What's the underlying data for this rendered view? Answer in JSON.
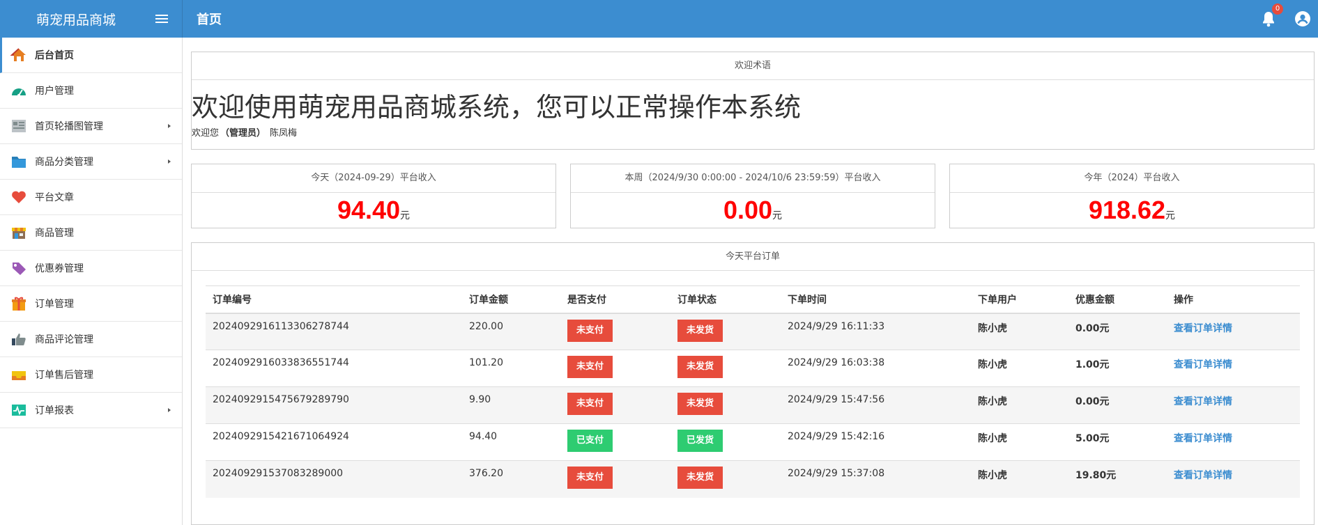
{
  "header": {
    "brand": "萌宠用品商城",
    "page_title": "首页",
    "notification_count": "0"
  },
  "sidebar": {
    "items": [
      {
        "label": "后台首页",
        "icon": "home-icon",
        "has_submenu": false
      },
      {
        "label": "用户管理",
        "icon": "dashboard-icon",
        "has_submenu": false
      },
      {
        "label": "首页轮播图管理",
        "icon": "newspaper-icon",
        "has_submenu": true
      },
      {
        "label": "商品分类管理",
        "icon": "folder-icon",
        "has_submenu": true
      },
      {
        "label": "平台文章",
        "icon": "heart-icon",
        "has_submenu": false
      },
      {
        "label": "商品管理",
        "icon": "store-icon",
        "has_submenu": false
      },
      {
        "label": "优惠券管理",
        "icon": "tag-icon",
        "has_submenu": false
      },
      {
        "label": "订单管理",
        "icon": "gift-icon",
        "has_submenu": false
      },
      {
        "label": "商品评论管理",
        "icon": "thumbs-up-icon",
        "has_submenu": false
      },
      {
        "label": "订单售后管理",
        "icon": "inbox-icon",
        "has_submenu": false
      },
      {
        "label": "订单报表",
        "icon": "chart-pulse-icon",
        "has_submenu": true
      }
    ]
  },
  "welcome": {
    "panel_title": "欢迎术语",
    "headline": "欢迎使用萌宠用品商城系统，您可以正常操作本系统",
    "greeting_prefix": "欢迎您",
    "role": "（管理员）",
    "username": "陈凤梅"
  },
  "stats": [
    {
      "title": "今天（2024-09-29）平台收入",
      "value": "94.40",
      "unit": "元"
    },
    {
      "title": "本周（2024/9/30 0:00:00 - 2024/10/6 23:59:59）平台收入",
      "value": "0.00",
      "unit": "元"
    },
    {
      "title": "今年（2024）平台收入",
      "value": "918.62",
      "unit": "元"
    }
  ],
  "orders": {
    "panel_title": "今天平台订单",
    "columns": [
      "订单编号",
      "订单金额",
      "是否支付",
      "订单状态",
      "下单时间",
      "下单用户",
      "优惠金额",
      "操作"
    ],
    "rows": [
      {
        "id": "20240929161133062787​44",
        "amount": "220.00",
        "paid": "未支付",
        "paid_ok": false,
        "status": "未发货",
        "status_ok": false,
        "time": "2024/9/29 16:11:33",
        "user": "陈小虎",
        "discount": "0.00元",
        "action": "查看订单详情"
      },
      {
        "id": "202409291603383655174​4",
        "amount": "101.20",
        "paid": "未支付",
        "paid_ok": false,
        "status": "未发货",
        "status_ok": false,
        "time": "2024/9/29 16:03:38",
        "user": "陈小虎",
        "discount": "1.00元",
        "action": "查看订单详情"
      },
      {
        "id": "20240929154756792897​90",
        "amount": "9.90",
        "paid": "未支付",
        "paid_ok": false,
        "status": "未发货",
        "status_ok": false,
        "time": "2024/9/29 15:47:56",
        "user": "陈小虎",
        "discount": "0.00元",
        "action": "查看订单详情"
      },
      {
        "id": "2024092915421671064924",
        "amount": "94.40",
        "paid": "已支付",
        "paid_ok": true,
        "status": "已发货",
        "status_ok": true,
        "time": "2024/9/29 15:42:16",
        "user": "陈小虎",
        "discount": "5.00元",
        "action": "查看订单详情"
      },
      {
        "id": "2024092915370832890​00",
        "amount": "376.20",
        "paid": "未支付",
        "paid_ok": false,
        "status": "未发货",
        "status_ok": false,
        "time": "2024/9/29 15:37:08",
        "user": "陈小虎",
        "discount": "19.80元",
        "action": "查看订单详情"
      }
    ]
  },
  "colors": {
    "header_bg": "#3c8dd0",
    "stat_value": "#ff0000",
    "unpaid_red": "#e74c3c",
    "paid_green": "#2ecc71",
    "link_blue": "#3c8dd0"
  }
}
